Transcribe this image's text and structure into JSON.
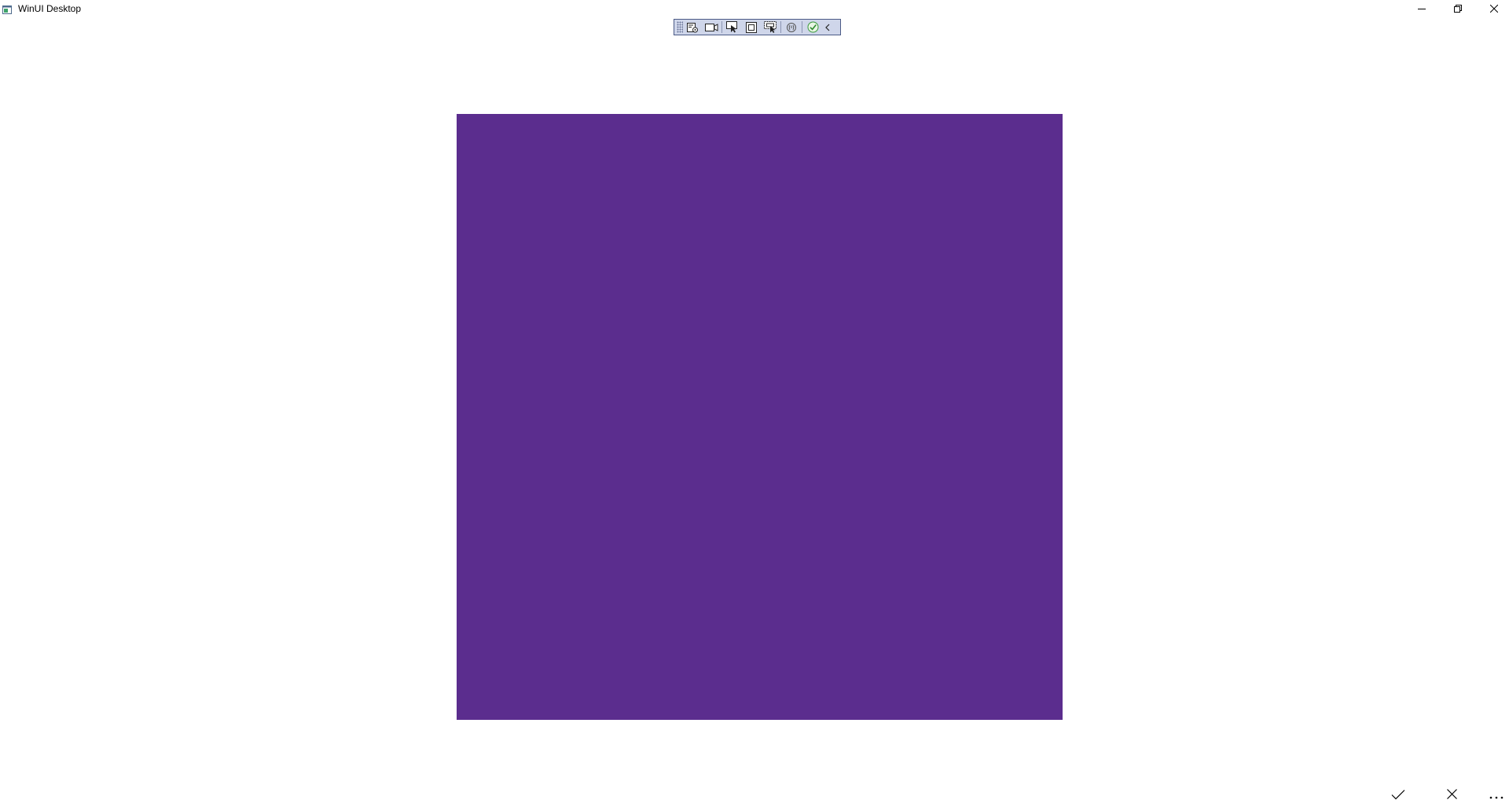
{
  "window": {
    "title": "WinUI Desktop",
    "icon": "app-window-icon"
  },
  "caption_buttons": {
    "minimize": "minimize-icon",
    "maximize": "restore-icon",
    "close": "close-icon"
  },
  "debug_toolbar": {
    "items": [
      "go-to-live-visual-tree-icon",
      "select-element-icon",
      "display-layout-adorners-icon",
      "track-focused-element-icon",
      "show-binding-failures-icon",
      "hot-reload-status-icon",
      "collapse-toolbar-icon"
    ]
  },
  "content": {
    "square_color": "#5b2d8e"
  },
  "command_bar": {
    "accept": "checkmark-icon",
    "cancel": "close-icon",
    "more": "more-icon"
  }
}
